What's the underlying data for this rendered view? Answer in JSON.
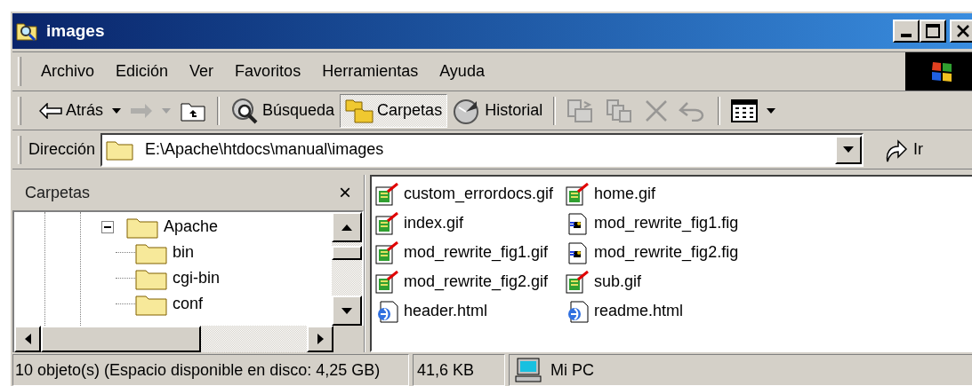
{
  "window": {
    "title": "images"
  },
  "menu": [
    "Archivo",
    "Edición",
    "Ver",
    "Favoritos",
    "Herramientas",
    "Ayuda"
  ],
  "toolbar": [
    {
      "kind": "split_button",
      "label": "Atrás",
      "disabled": false,
      "selected": false
    },
    {
      "kind": "split_button",
      "disabled": true,
      "selected": false
    },
    {
      "kind": "button",
      "disabled": false,
      "selected": false
    },
    {
      "kind": "separator"
    },
    {
      "kind": "button",
      "label": "Búsqueda",
      "disabled": false,
      "selected": false
    },
    {
      "kind": "button",
      "label": "Carpetas",
      "disabled": false,
      "selected": true
    },
    {
      "kind": "button",
      "label": "Historial",
      "disabled": false,
      "selected": false
    },
    {
      "kind": "separator"
    },
    {
      "kind": "button",
      "disabled": true,
      "selected": false
    },
    {
      "kind": "button",
      "disabled": true,
      "selected": false
    },
    {
      "kind": "button",
      "disabled": true,
      "selected": false
    },
    {
      "kind": "button",
      "disabled": true,
      "selected": false
    },
    {
      "kind": "separator"
    },
    {
      "kind": "split_button",
      "disabled": false,
      "selected": false
    }
  ],
  "address": {
    "label": "Dirección",
    "value": "E:\\Apache\\htdocs\\manual\\images",
    "go": "Ir"
  },
  "folders_pane": {
    "title": "Carpetas",
    "close": "×",
    "tree": [
      {
        "label": "Apache",
        "expanded": true,
        "children": [
          {
            "label": "bin"
          },
          {
            "label": "cgi-bin"
          },
          {
            "label": "conf"
          }
        ]
      }
    ]
  },
  "files": [
    {
      "name": "custom_errordocs.gif",
      "kind": "gif"
    },
    {
      "name": "index.gif",
      "kind": "gif"
    },
    {
      "name": "mod_rewrite_fig1.gif",
      "kind": "gif"
    },
    {
      "name": "mod_rewrite_fig2.gif",
      "kind": "gif"
    },
    {
      "name": "header.html",
      "kind": "html"
    },
    {
      "name": "home.gif",
      "kind": "gif"
    },
    {
      "name": "mod_rewrite_fig1.fig",
      "kind": "fig"
    },
    {
      "name": "mod_rewrite_fig2.fig",
      "kind": "fig"
    },
    {
      "name": "sub.gif",
      "kind": "gif"
    },
    {
      "name": "readme.html",
      "kind": "html"
    }
  ],
  "status_bar": {
    "objects": "10 objeto(s) (Espacio disponible en disco: 4,25 GB)",
    "size": "41,6 KB",
    "zone": "Mi PC"
  }
}
